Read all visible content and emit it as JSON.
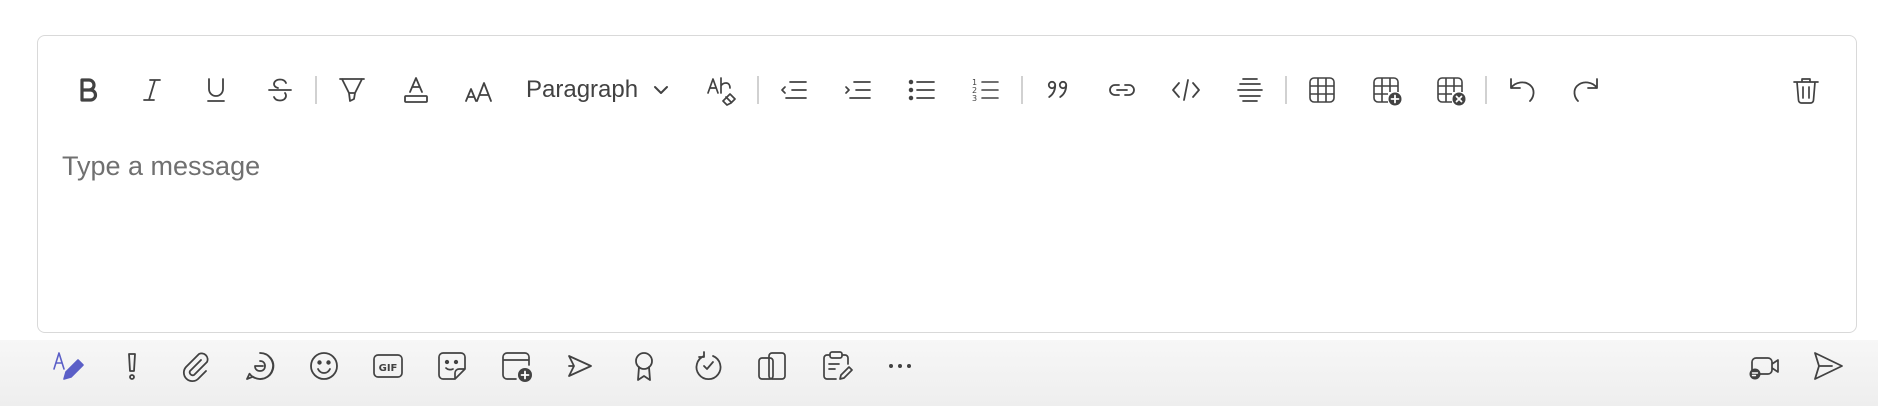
{
  "toolbar": {
    "paragraph_label": "Paragraph",
    "icons": [
      "bold-icon",
      "italic-icon",
      "underline-icon",
      "strikethrough-icon",
      "highlight-icon",
      "font-color-icon",
      "font-size-icon",
      "paragraph-chevron-icon",
      "clear-formatting-icon",
      "decrease-indent-icon",
      "increase-indent-icon",
      "bulleted-list-icon",
      "numbered-list-icon",
      "quote-icon",
      "link-icon",
      "code-snippet-icon",
      "horizontal-rule-icon",
      "table-icon",
      "insert-table-row-icon",
      "delete-table-icon",
      "undo-icon",
      "redo-icon",
      "delete-draft-icon"
    ]
  },
  "message": {
    "placeholder": "Type a message",
    "value": ""
  },
  "bottom_bar": {
    "icons": [
      "format-icon",
      "important-icon",
      "attach-icon",
      "loop-icon",
      "emoji-icon",
      "gif-icon",
      "sticker-icon",
      "schedule-meeting-icon",
      "stream-icon",
      "praise-icon",
      "updates-icon",
      "apps-icon",
      "forms-icon",
      "more-options-icon",
      "meet-now-icon",
      "send-icon"
    ]
  },
  "colors": {
    "accent": "#5b5fc7",
    "icon": "#424242",
    "border": "#d9d9d9",
    "placeholder": "#707070"
  }
}
